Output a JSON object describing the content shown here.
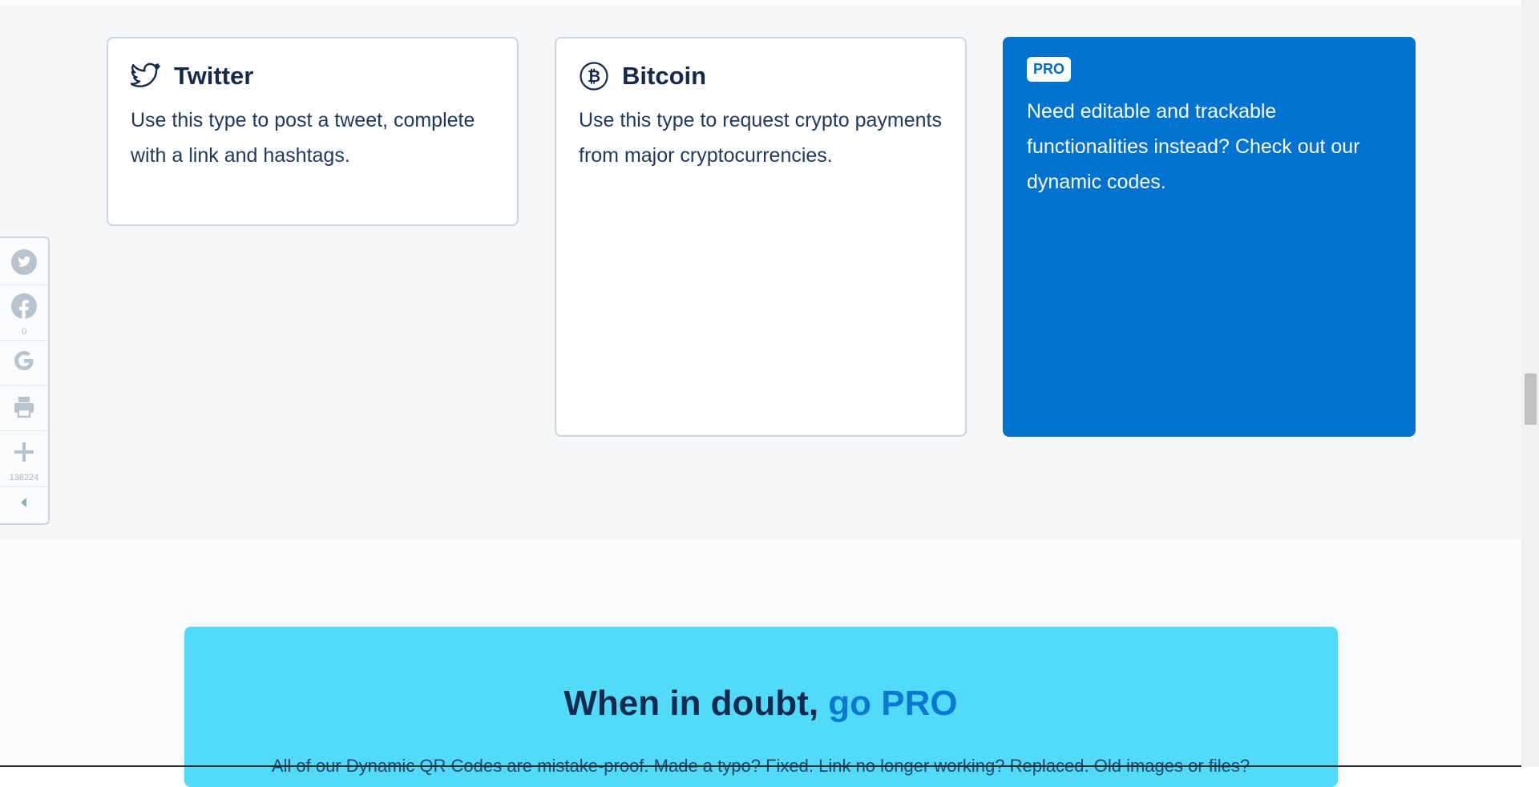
{
  "cards": [
    {
      "title": "Twitter",
      "description": "Use this type to post a tweet, complete with a link and hashtags.",
      "icon": "twitter-icon"
    },
    {
      "title": "Bitcoin",
      "description": "Use this type to request crypto payments from major cryptocurrencies.",
      "icon": "bitcoin-icon"
    }
  ],
  "pro_card": {
    "badge": "PRO",
    "text": "Need editable and trackable functionalities instead? Check out our dynamic codes.",
    "background": "#0073d1"
  },
  "share_bar": {
    "facebook_count": "0",
    "total_count": "138224",
    "icons": [
      "twitter-icon",
      "facebook-icon",
      "google-icon",
      "print-icon",
      "plus-icon",
      "collapse-icon"
    ]
  },
  "cta": {
    "title_prefix": "When in doubt, ",
    "title_highlight": "go PRO",
    "subtitle": "All of our Dynamic QR Codes are mistake-proof. Made a typo? Fixed. Link no longer working? Replaced. Old images or files?",
    "background": "#52daf9"
  }
}
